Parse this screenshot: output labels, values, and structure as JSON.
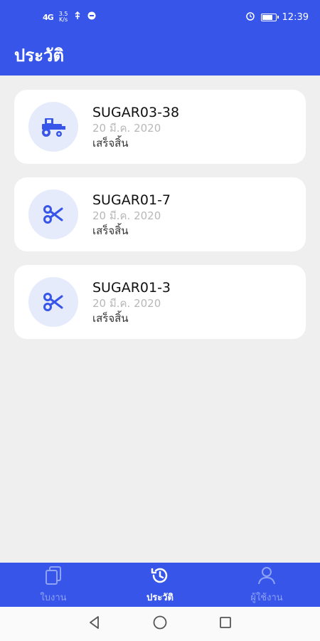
{
  "status_bar": {
    "signal": "4G",
    "speed_value": "3.5",
    "speed_unit": "K/s",
    "time": "12:39"
  },
  "app_bar": {
    "title": "ประวัติ"
  },
  "history": [
    {
      "title": "SUGAR03-38",
      "date": "20 มี.ค. 2020",
      "status": "เสร็จสิ้น",
      "icon": "tractor-icon"
    },
    {
      "title": "SUGAR01-7",
      "date": "20 มี.ค. 2020",
      "status": "เสร็จสิ้น",
      "icon": "scissors-icon"
    },
    {
      "title": "SUGAR01-3",
      "date": "20 มี.ค. 2020",
      "status": "เสร็จสิ้น",
      "icon": "scissors-icon"
    }
  ],
  "bottom_nav": {
    "items": [
      {
        "label": "ใบงาน",
        "icon": "documents-icon",
        "active": false
      },
      {
        "label": "ประวัติ",
        "icon": "history-icon",
        "active": true
      },
      {
        "label": "ผู้ใช้งาน",
        "icon": "user-icon",
        "active": false
      }
    ]
  },
  "colors": {
    "primary": "#3756e9",
    "icon_bg": "#e6ebfb",
    "background": "#efefef"
  }
}
